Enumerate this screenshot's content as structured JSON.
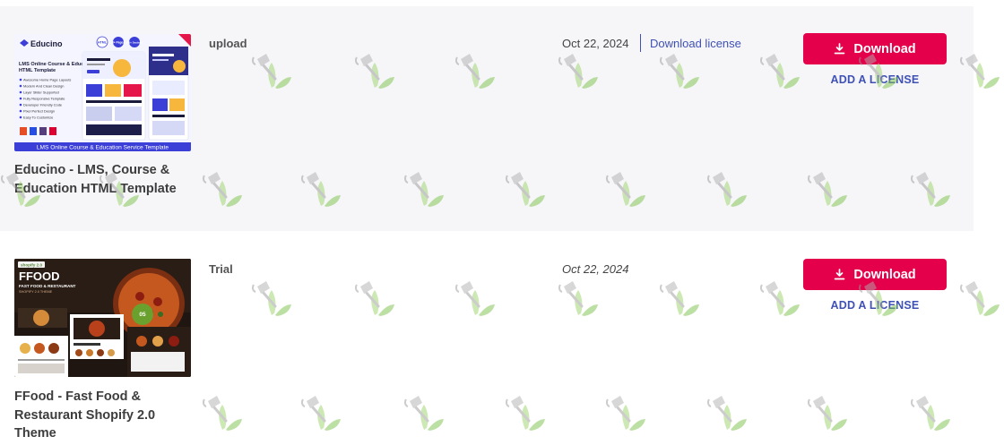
{
  "items": [
    {
      "thumb": {
        "brand": "Educino",
        "headline_line1": "LMS Online Course & Education Service",
        "headline_line2": "HTML Template",
        "badges": [
          "HTML",
          "3+ Pages",
          "150+ Sections"
        ],
        "features": [
          "Awesome Home Page Layouts",
          "Modern And Clean Design",
          "Layer Slider Supported",
          "Fully Responsive Template",
          "Developer Friendly Code",
          "Pixel Perfect Design",
          "Easy To Customize"
        ],
        "footer": "LMS Online Course & Education Service Template"
      },
      "title_line1": "Educino - LMS, Course &",
      "title_line2": "Education HTML Template",
      "type": "upload",
      "date": "Oct 22, 2024",
      "license_link": "Download license",
      "download_label": "Download",
      "add_license": "ADD A LICENSE"
    },
    {
      "thumb": {
        "badge": "shopify 2.0",
        "brand": "FFOOD",
        "tag1": "FAST FOOD & RESTAURANT",
        "tag2": "SHOPIFY 2.0 THEME",
        "sticker": "05"
      },
      "title_line1": "FFood - Fast Food &",
      "title_line2": "Restaurant Shopify 2.0",
      "title_line3": "Theme",
      "type": "Trial",
      "date": "Oct 22, 2024",
      "download_label": "Download",
      "add_license": "ADD A LICENSE"
    }
  ],
  "colors": {
    "accent": "#e4004b",
    "link": "#3f51b5",
    "row_bg": "#f6f6f9"
  },
  "icons": {
    "download": "download-icon",
    "watermark": "shovel-sprout-icon"
  }
}
